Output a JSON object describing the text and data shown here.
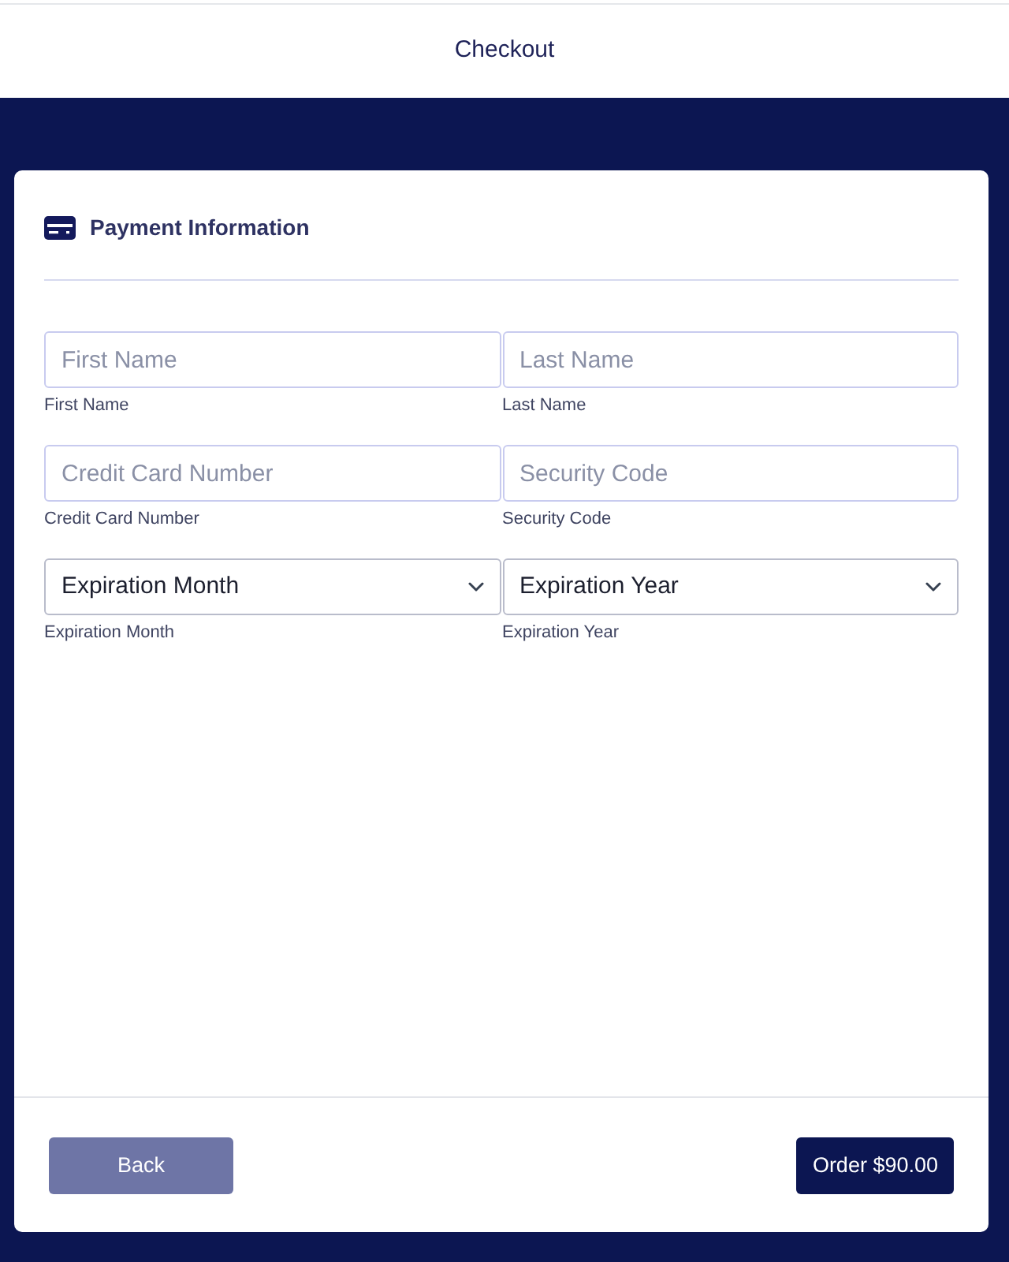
{
  "header": {
    "title": "Checkout"
  },
  "section": {
    "title": "Payment Information"
  },
  "fields": [
    {
      "kind": "input",
      "placeholder": "First Name",
      "label": "First Name"
    },
    {
      "kind": "input",
      "placeholder": "Last Name",
      "label": "Last Name"
    },
    {
      "kind": "input",
      "placeholder": "Credit Card Number",
      "label": "Credit Card Number"
    },
    {
      "kind": "input",
      "placeholder": "Security Code",
      "label": "Security Code"
    },
    {
      "kind": "select",
      "value": "Expiration Month",
      "label": "Expiration Month"
    },
    {
      "kind": "select",
      "value": "Expiration Year",
      "label": "Expiration Year"
    }
  ],
  "buttons": [
    {
      "kind": "secondary",
      "label": "Back"
    },
    {
      "kind": "primary",
      "label": "Order $90.00"
    }
  ]
}
